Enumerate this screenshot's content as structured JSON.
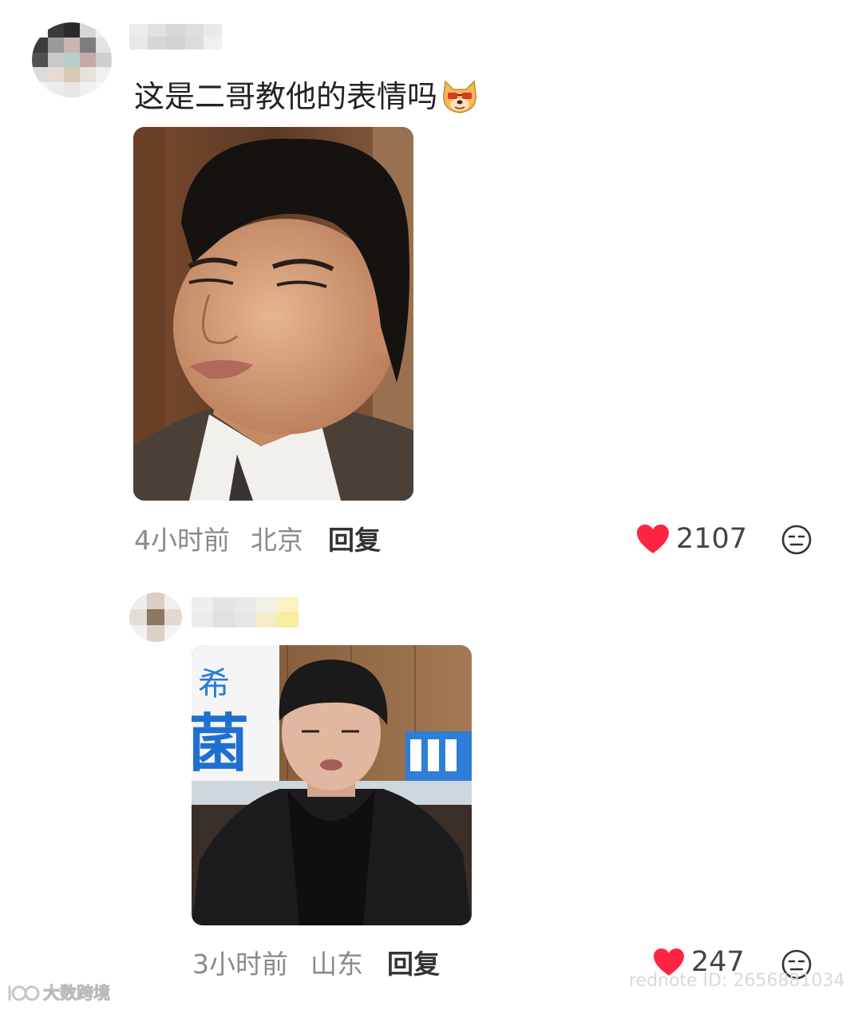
{
  "comments": [
    {
      "text": "这是二哥教他的表情吗",
      "emoji": "dog-sunglasses-emoji",
      "image_desc": "man-smirking-photo",
      "time": "4小时前",
      "location": "北京",
      "reply_label": "回复",
      "likes": "2107"
    },
    {
      "image_desc": "young-man-black-jacket-photo",
      "image_sign_text": [
        "希",
        "菌"
      ],
      "time": "3小时前",
      "location": "山东",
      "reply_label": "回复",
      "likes": "247"
    }
  ],
  "watermarks": {
    "brand": "大数跨境",
    "rednote": "rednote ID: 2656881034"
  },
  "colors": {
    "like": "#ff2442",
    "meta": "#8a8a8a"
  }
}
